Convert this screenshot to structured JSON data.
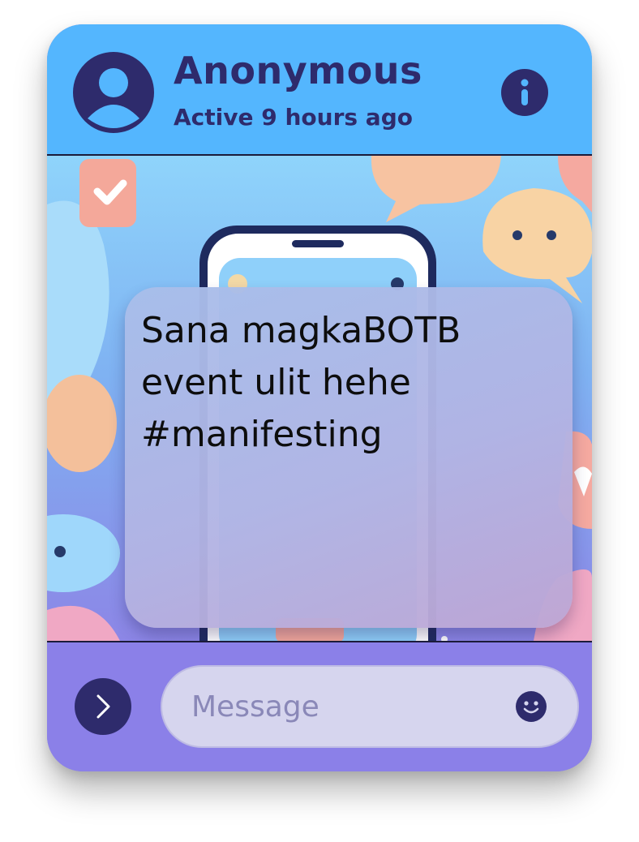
{
  "header": {
    "contact_name": "Anonymous",
    "status": "Active 9 hours ago",
    "avatar_icon": "user-avatar-icon",
    "info_icon": "info-icon"
  },
  "conversation": {
    "messages": [
      {
        "text": "Sana magkaBOTB\nevent ulit hehe\n#manifesting"
      }
    ]
  },
  "composer": {
    "placeholder": "Message",
    "send_icon": "chevron-right-icon",
    "emoji_icon": "smiley-icon"
  },
  "colors": {
    "header_bg": "#54b6fe",
    "footer_bg": "#8b80e8",
    "accent_dark": "#2e2b6c",
    "input_bg": "#d6d5ee"
  }
}
